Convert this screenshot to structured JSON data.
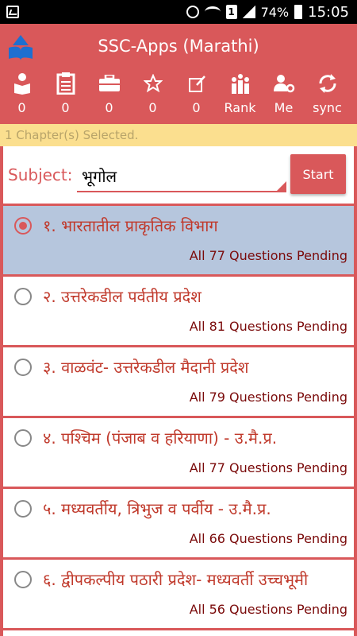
{
  "status_bar": {
    "icons": [
      "gallery-icon",
      "alarm-icon",
      "wifi-icon",
      "sim-icon",
      "signal-icon",
      "battery-icon"
    ],
    "sim_label": "1",
    "battery": "74%",
    "time": "15:05"
  },
  "app": {
    "title": "SSC-Apps (Marathi)",
    "colors": {
      "primary": "#d9585a",
      "banner": "#fbdf8f",
      "selected_row": "#b6c6dd"
    }
  },
  "toolbar": {
    "items": [
      {
        "icon": "reader-icon",
        "label": "0"
      },
      {
        "icon": "clipboard-icon",
        "label": "0"
      },
      {
        "icon": "briefcase-icon",
        "label": "0"
      },
      {
        "icon": "star-icon",
        "label": "0"
      },
      {
        "icon": "edit-note-icon",
        "label": "0"
      },
      {
        "icon": "rank-icon",
        "label": "Rank"
      },
      {
        "icon": "user-settings-icon",
        "label": "Me"
      },
      {
        "icon": "sync-icon",
        "label": "sync"
      }
    ]
  },
  "banner": {
    "text": "1 Chapter(s) Selected."
  },
  "subject": {
    "label": "Subject:",
    "value": "भूगोल",
    "start_label": "Start"
  },
  "chapters": [
    {
      "name": "१. भारतातील प्राकृतिक विभाग",
      "pending": "All 77 Questions Pending",
      "selected": true
    },
    {
      "name": "२. उत्तरेकडील पर्वतीय प्रदेश",
      "pending": "All 81 Questions Pending",
      "selected": false
    },
    {
      "name": "३. वाळवंट- उत्तरेकडील मैदानी प्रदेश",
      "pending": "All 79 Questions Pending",
      "selected": false
    },
    {
      "name": "४. पश्चिम (पंजाब व हरियाणा) - उ.मै.प्र.",
      "pending": "All 77 Questions Pending",
      "selected": false
    },
    {
      "name": "५. मध्यवर्तीय, त्रिभुज व पर्वीय - उ.मै.प्र.",
      "pending": "All 66 Questions Pending",
      "selected": false
    },
    {
      "name": "६. द्वीपकल्पीय पठारी प्रदेश- मध्यवर्ती उच्चभूमी",
      "pending": "All 56 Questions Pending",
      "selected": false
    }
  ]
}
